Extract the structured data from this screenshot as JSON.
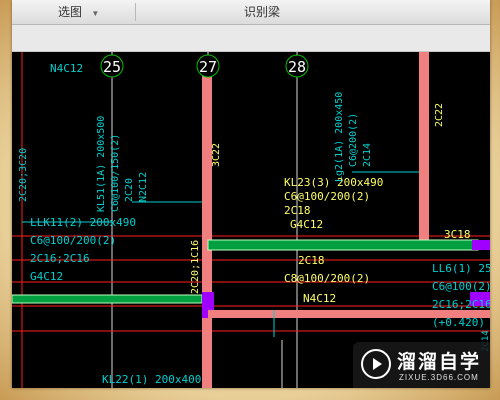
{
  "toolbar": {
    "tab_left": "选图",
    "tab_center": "识别梁"
  },
  "axes": [
    "25",
    "27",
    "28"
  ],
  "beam_labels": {
    "top_left": "N4C12",
    "left_vertical_1": "2C20;3C20",
    "kl51_line1": "KL51(1A) 200x500",
    "kl51_line2": "C6@100/150(2)",
    "kl51_line3": "2C20",
    "kl51_line4": "N2C12",
    "lg2_line1": "Lg2(1A) 200x450",
    "lg2_line2": "C6@200(2)",
    "lg2_line3": "2C14",
    "right_vertical": "2C22",
    "col27_vertical": "3C22",
    "kl23_line1": "KL23(3) 200x490",
    "kl23_line2": "C6@100/200(2)",
    "kl23_line3": "2C18",
    "kl23_line4": "G4C12",
    "right_3c18": "3C18",
    "llk_line1": "LLK11(2) 200x490",
    "llk_line2": "C6@100/200(2)",
    "llk_line3": "2C16;2C16",
    "llk_line4": "G4C12",
    "col27_vertical_2": "2C20;1C16",
    "mid_2c18": "2C18",
    "mid_c8": "C8@100/200(2)",
    "mid_n4c12": "N4C12",
    "ll6_line1": "LL6(1) 250x",
    "ll6_line2": "C6@100(2)",
    "ll6_line3": "2C16;2C16",
    "ll6_line4": "(+0.420)",
    "bottom_kl22": "KL22(1) 200x400",
    "bottom_right": "2C14"
  },
  "watermark": {
    "title": "溜溜自学",
    "url": "ZIXUE.3D66.COM"
  },
  "colors": {
    "beam_fill": "#f08080",
    "cyan_text": "#00d0d0",
    "yellow_text": "#ffff66",
    "red_line": "#ff2020",
    "green_beam": "#00a040",
    "purple": "#a000ff",
    "axis_green": "#00c000"
  }
}
